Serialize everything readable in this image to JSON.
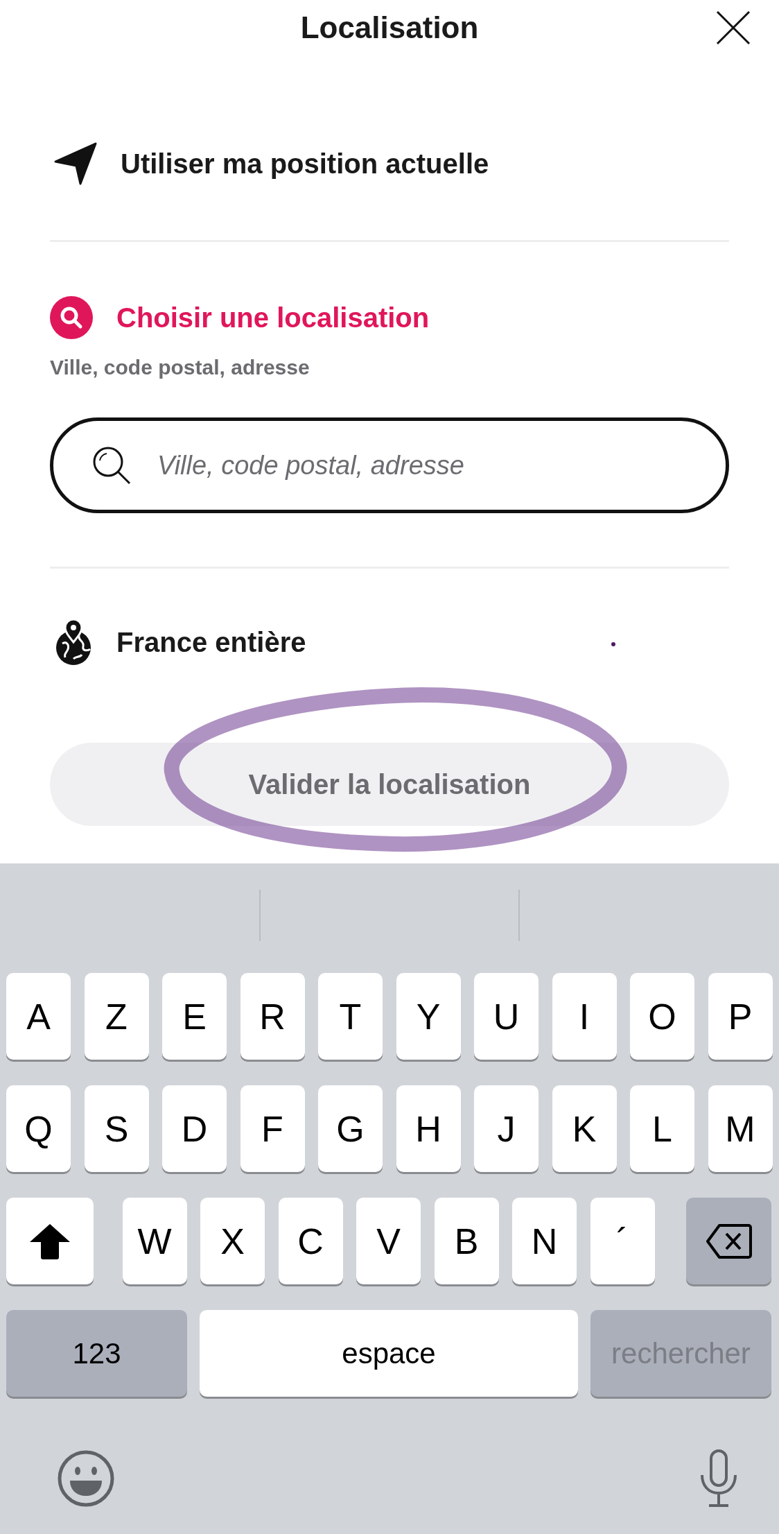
{
  "header": {
    "title": "Localisation"
  },
  "current_position": {
    "label": "Utiliser ma position actuelle"
  },
  "choose_location": {
    "title": "Choisir une localisation",
    "subtitle": "Ville, code postal, adresse",
    "search": {
      "placeholder": "Ville, code postal, adresse"
    }
  },
  "whole_country": {
    "label": "France entière"
  },
  "validate_button": {
    "label": "Valider la localisation",
    "disabled": true
  },
  "keyboard": {
    "key_rows": [
      {
        "keys": [
          {
            "kind": "letter",
            "label": "A"
          },
          {
            "kind": "letter",
            "label": "Z"
          },
          {
            "kind": "letter",
            "label": "E"
          },
          {
            "kind": "letter",
            "label": "R"
          },
          {
            "kind": "letter",
            "label": "T"
          },
          {
            "kind": "letter",
            "label": "Y"
          },
          {
            "kind": "letter",
            "label": "U"
          },
          {
            "kind": "letter",
            "label": "I"
          },
          {
            "kind": "letter",
            "label": "O"
          },
          {
            "kind": "letter",
            "label": "P"
          }
        ]
      },
      {
        "keys": [
          {
            "kind": "letter",
            "label": "Q"
          },
          {
            "kind": "letter",
            "label": "S"
          },
          {
            "kind": "letter",
            "label": "D"
          },
          {
            "kind": "letter",
            "label": "F"
          },
          {
            "kind": "letter",
            "label": "G"
          },
          {
            "kind": "letter",
            "label": "H"
          },
          {
            "kind": "letter",
            "label": "J"
          },
          {
            "kind": "letter",
            "label": "K"
          },
          {
            "kind": "letter",
            "label": "L"
          },
          {
            "kind": "letter",
            "label": "M"
          }
        ]
      },
      {
        "keys": [
          {
            "kind": "shift"
          },
          {
            "kind": "letter",
            "label": "W"
          },
          {
            "kind": "letter",
            "label": "X"
          },
          {
            "kind": "letter",
            "label": "C"
          },
          {
            "kind": "letter",
            "label": "V"
          },
          {
            "kind": "letter",
            "label": "B"
          },
          {
            "kind": "letter",
            "label": "N"
          },
          {
            "kind": "letter",
            "label": "´"
          },
          {
            "kind": "delete"
          }
        ]
      },
      {
        "keys": [
          {
            "kind": "numbers",
            "label": "123"
          },
          {
            "kind": "space",
            "label": "espace"
          },
          {
            "kind": "return",
            "label": "rechercher",
            "disabled": true
          }
        ]
      }
    ]
  }
}
